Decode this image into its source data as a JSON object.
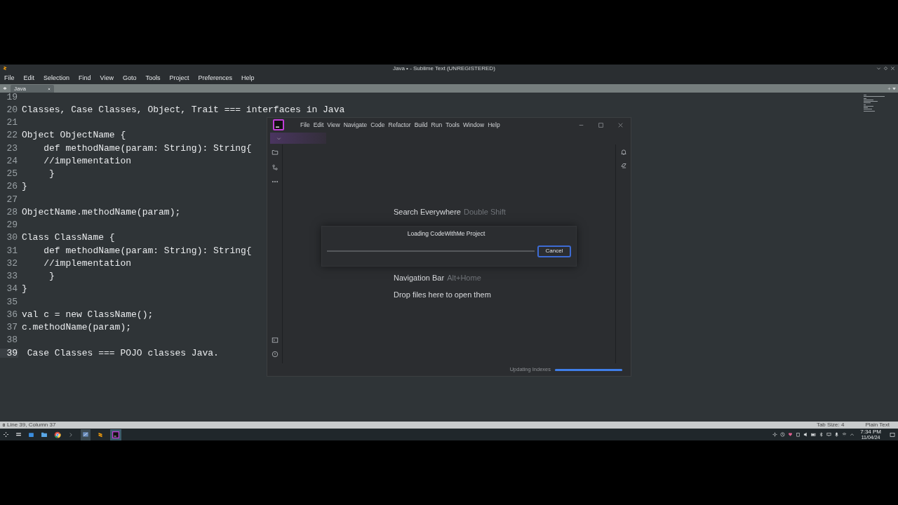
{
  "sublime": {
    "title": "Java • - Sublime Text (UNREGISTERED)",
    "menu": [
      "File",
      "Edit",
      "Selection",
      "Find",
      "View",
      "Goto",
      "Tools",
      "Project",
      "Preferences",
      "Help"
    ],
    "tab": {
      "label": "Java"
    },
    "lines": [
      {
        "number": "19",
        "current": false
      },
      {
        "number": "20",
        "text": "Classes, Case Classes, Object, Trait === interfaces in Java",
        "current": false
      },
      {
        "number": "21",
        "current": false
      },
      {
        "number": "22",
        "text": "Object ObjectName {",
        "current": false
      },
      {
        "number": "23",
        "text": "    def methodName(param: String): String{",
        "current": false
      },
      {
        "number": "24",
        "text": "    //implementation",
        "current": false
      },
      {
        "number": "25",
        "text": "     }",
        "current": false
      },
      {
        "number": "26",
        "text": "}",
        "current": false
      },
      {
        "number": "27",
        "current": false
      },
      {
        "number": "28",
        "text": "ObjectName.methodName(param);",
        "current": false
      },
      {
        "number": "29",
        "current": false
      },
      {
        "number": "30",
        "text": "Class ClassName {",
        "current": false
      },
      {
        "number": "31",
        "text": "    def methodName(param: String): String{",
        "current": false
      },
      {
        "number": "32",
        "text": "    //implementation",
        "current": false
      },
      {
        "number": "33",
        "text": "     }",
        "current": false
      },
      {
        "number": "34",
        "text": "}",
        "current": false
      },
      {
        "number": "35",
        "current": false
      },
      {
        "number": "36",
        "text": "val c = new ClassName();",
        "current": false
      },
      {
        "number": "37",
        "text": "c.methodName(param);",
        "current": false
      },
      {
        "number": "38",
        "current": false
      },
      {
        "number": "39",
        "text": " Case Classes === POJO classes Java.",
        "current": true
      }
    ],
    "status": {
      "position": "Line 39, Column 37",
      "tab_size": "Tab Size: 4",
      "syntax": "Plain Text"
    }
  },
  "intellij": {
    "menu": [
      "File",
      "Edit",
      "View",
      "Navigate",
      "Code",
      "Refactor",
      "Build",
      "Run",
      "Tools",
      "Window",
      "Help"
    ],
    "welcome_top": [
      {
        "action": "Search Everywhere",
        "shortcut": "Double Shift"
      }
    ],
    "welcome_bottom": [
      {
        "action": "Navigation Bar",
        "shortcut": "Alt+Home"
      }
    ],
    "drop_hint": "Drop files here to open them",
    "dialog": {
      "title": "Loading CodeWithMe Project",
      "button": "Cancel"
    },
    "status": {
      "label": "Updating Indexes",
      "level": 1
    }
  },
  "taskbar": {
    "time": "7:34 PM",
    "date": "11/04/24"
  }
}
